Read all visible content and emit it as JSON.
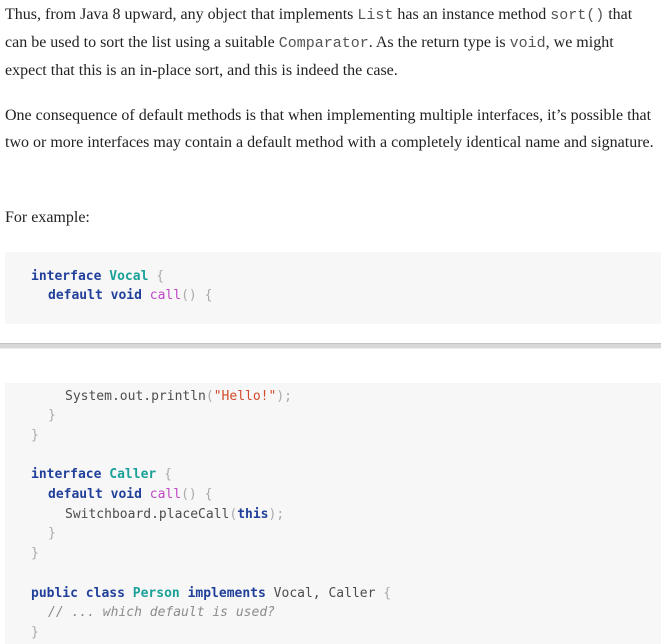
{
  "paragraphs": {
    "p1": {
      "a": "Thus, from Java 8 upward, any object that implements ",
      "code1": "List",
      "b": " has an instance method ",
      "code2": "sort()",
      "c": " that can be used to sort the list using a suitable ",
      "code3": "Comparator",
      "d": ". As the return type is ",
      "code4": "void",
      "e": ", we might expect that this is an in-place sort, and this is indeed the case."
    },
    "p2": "One consequence of default methods is that when implementing multiple interfaces, it’s possible that two or more interfaces may contain a default method with a completely identical name and signature.",
    "p3": "For example:"
  },
  "code_top": {
    "l1": {
      "kw": "interface",
      "type": "Vocal",
      "brace": "{"
    },
    "l2": {
      "kw1": "default",
      "kw2": "void",
      "fn": "call",
      "paren": "()",
      "brace": "{"
    }
  },
  "code_bottom": {
    "l1": {
      "obj": "System.out.println",
      "open": "(",
      "str": "\"Hello!\"",
      "close": ");"
    },
    "l2": "}",
    "l3": "}",
    "l4": {
      "kw": "interface",
      "type": "Caller",
      "brace": "{"
    },
    "l5": {
      "kw1": "default",
      "kw2": "void",
      "fn": "call",
      "paren": "()",
      "brace": "{"
    },
    "l6": {
      "obj": "Switchboard.placeCall",
      "open": "(",
      "kw": "this",
      "close": ");"
    },
    "l7": "}",
    "l8": "}",
    "l9": {
      "kw1": "public",
      "kw2": "class",
      "type": "Person",
      "kw3": "implements",
      "rest": "Vocal, Caller",
      "brace": "{"
    },
    "l10": "// ... which default is used?",
    "l11": "}"
  }
}
